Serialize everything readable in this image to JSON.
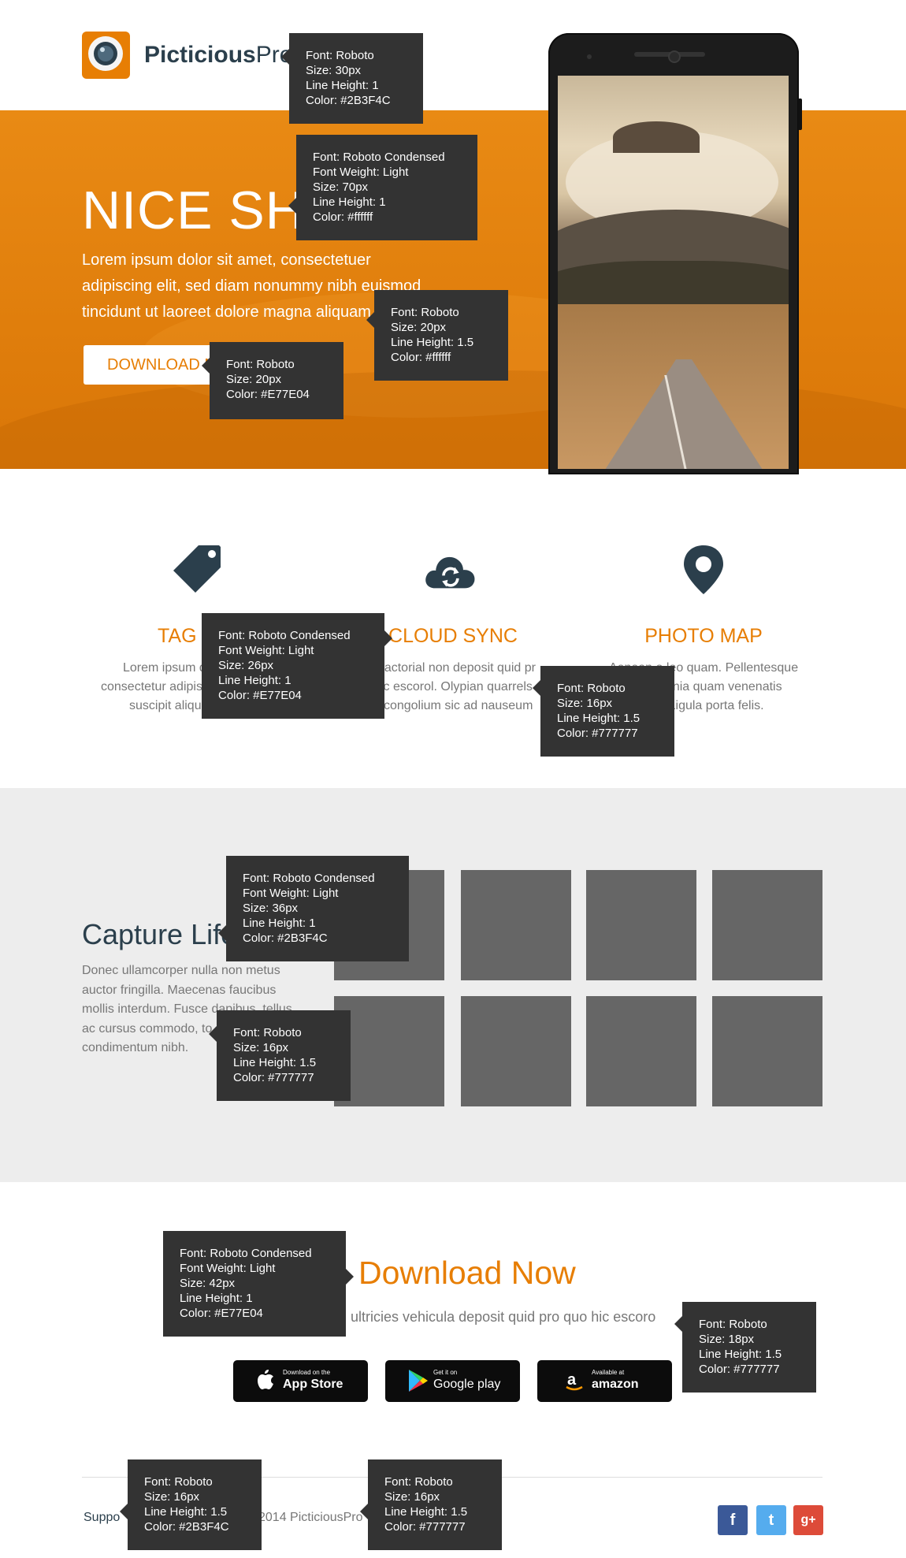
{
  "brand": {
    "name_bold": "Picticious",
    "name_light": "Pro"
  },
  "hero": {
    "title": "NICE SHOT",
    "lead": "Lorem ipsum dolor sit amet, consectetuer adipiscing elit, sed diam nonummy nibh euismod tincidunt ut laoreet dolore magna aliquam",
    "button": "DOWNLOAD N"
  },
  "features": [
    {
      "icon": "tag-icon",
      "title": "TAG I",
      "lines": [
        "Lorem ipsum d",
        "consectetur adipis",
        "suscipit aliqu"
      ]
    },
    {
      "icon": "cloud-sync-icon",
      "title": "CLOUD SYNC",
      "lines": [
        "n factorial non deposit quid pr",
        "hic escorol. Olypian quarrels",
        "a congolium sic ad nauseum"
      ]
    },
    {
      "icon": "map-pin-icon",
      "title": "PHOTO MAP",
      "lines": [
        "Aenean o leo quam. Pellentesque",
        "acinia quam venenatis",
        "m. Ligula porta felis."
      ]
    }
  ],
  "capture": {
    "title": "Capture Life",
    "lines": [
      "Donec ullamcorper nulla non metus",
      "auctor fringilla. Maecenas faucibus",
      "mollis interdum. Fusce dapibus, tellus",
      "ac cursus commodo, to",
      "condimentum nibh."
    ]
  },
  "download": {
    "title": "Download Now",
    "text": "bh ultricies vehicula deposit quid pro quo hic escoro",
    "stores": [
      {
        "small": "Download on the",
        "large": "App Store",
        "icon": "apple-icon"
      },
      {
        "small": "Get it on",
        "large": "Google play",
        "icon": "google-play-icon"
      },
      {
        "small": "Available at",
        "large": "amazon",
        "icon": "amazon-icon"
      }
    ]
  },
  "footer": {
    "support": "Suppo",
    "copyright": "2014 PicticiousPro",
    "social": [
      {
        "icon": "facebook-icon",
        "glyph": "f",
        "color": "#3b5998"
      },
      {
        "icon": "twitter-icon",
        "glyph": "t",
        "color": "#55acee"
      },
      {
        "icon": "google-plus-icon",
        "glyph": "g+",
        "color": "#dd4b39"
      }
    ]
  },
  "annotations": [
    {
      "id": "logo",
      "lines": [
        "Font: Roboto",
        "Size: 30px",
        "Line Height: 1",
        "Color: #2B3F4C"
      ]
    },
    {
      "id": "hero-title",
      "lines": [
        "Font: Roboto Condensed",
        "Font Weight: Light",
        "Size: 70px",
        "Line Height: 1",
        "Color: #ffffff"
      ]
    },
    {
      "id": "hero-lead",
      "lines": [
        "Font: Roboto",
        "Size: 20px",
        "Line Height: 1.5",
        "Color: #ffffff"
      ]
    },
    {
      "id": "hero-button",
      "lines": [
        "Font: Roboto",
        "Size: 20px",
        "Color: #E77E04"
      ]
    },
    {
      "id": "feature-title",
      "lines": [
        "Font: Roboto Condensed",
        "Font Weight: Light",
        "Size: 26px",
        "Line Height: 1",
        "Color: #E77E04"
      ]
    },
    {
      "id": "feature-text",
      "lines": [
        "Font: Roboto",
        "Size: 16px",
        "Line Height: 1.5",
        "Color: #777777"
      ]
    },
    {
      "id": "capture-title",
      "lines": [
        "Font: Roboto Condensed",
        "Font Weight: Light",
        "Size: 36px",
        "Line Height: 1",
        "Color: #2B3F4C"
      ]
    },
    {
      "id": "capture-text",
      "lines": [
        "Font: Roboto",
        "Size: 16px",
        "Line Height: 1.5",
        "Color: #777777"
      ]
    },
    {
      "id": "download-title",
      "lines": [
        "Font: Roboto Condensed",
        "Font Weight: Light",
        "Size: 42px",
        "Line Height: 1",
        "Color: #E77E04"
      ]
    },
    {
      "id": "download-text",
      "lines": [
        "Font: Roboto",
        "Size: 18px",
        "Line Height: 1.5",
        "Color: #777777"
      ]
    },
    {
      "id": "footer-support",
      "lines": [
        "Font: Roboto",
        "Size: 16px",
        "Line Height: 1.5",
        "Color: #2B3F4C"
      ]
    },
    {
      "id": "footer-copy",
      "lines": [
        "Font: Roboto",
        "Size: 16px",
        "Line Height: 1.5",
        "Color: #777777"
      ]
    }
  ]
}
